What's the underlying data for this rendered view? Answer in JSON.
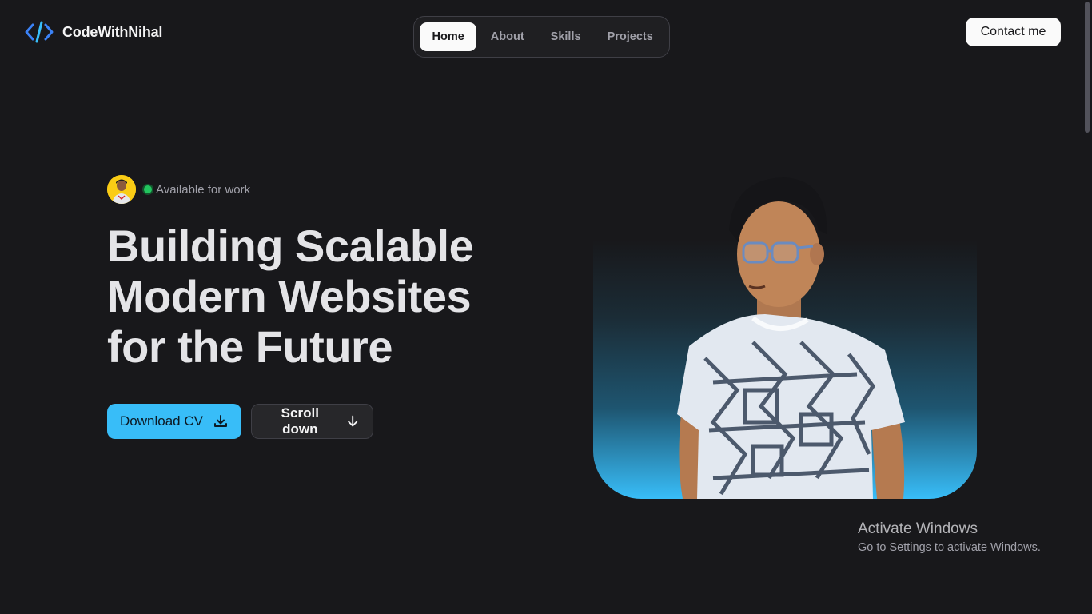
{
  "header": {
    "logo_text": "CodeWithNihal",
    "logo_icon": "code-brackets-icon",
    "nav": [
      {
        "label": "Home",
        "active": true
      },
      {
        "label": "About",
        "active": false
      },
      {
        "label": "Skills",
        "active": false
      },
      {
        "label": "Projects",
        "active": false
      }
    ],
    "contact_label": "Contact me"
  },
  "hero": {
    "status": "Available for work",
    "headline": [
      "Building Scalable",
      "Modern Websites",
      "for the Future"
    ],
    "primary_button": {
      "label": "Download CV",
      "icon": "download-icon"
    },
    "secondary_button": {
      "label": "Scroll down",
      "icon": "arrow-down-icon"
    }
  },
  "watermark": {
    "title": "Activate Windows",
    "subtitle": "Go to Settings to activate Windows."
  },
  "colors": {
    "accent": "#38bdf8",
    "background": "#18181b",
    "status_green": "#22c55e"
  }
}
